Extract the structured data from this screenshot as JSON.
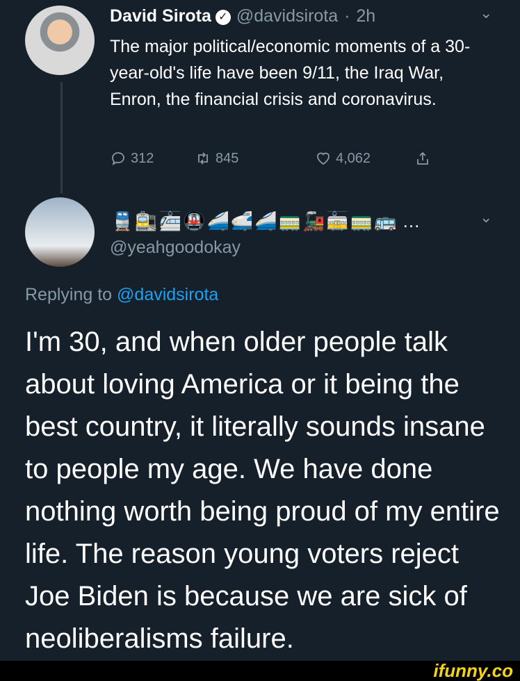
{
  "original_tweet": {
    "display_name": "David Sirota",
    "handle": "@davidsirota",
    "separator": "·",
    "time": "2h",
    "text": "The major political/economic moments of a 30-year-old's life have been 9/11, the Iraq War, Enron, the financial crisis and coronavirus.",
    "replies": "312",
    "retweets": "845",
    "likes": "4,062",
    "icons": {
      "verified": "verified-badge-icon",
      "reply": "reply-icon",
      "retweet": "retweet-icon",
      "like": "heart-icon",
      "share": "share-icon",
      "menu": "chevron-down-icon"
    }
  },
  "reply_tweet": {
    "display_name_emoji": "🚆🚉🚈🚇🚄🚅🚄🚃🚂🚋🚃🚌",
    "ellipsis": "…",
    "handle": "@yeahgoodokay",
    "replying_to_label": "Replying to",
    "replying_to_handle": "@davidsirota",
    "text": "I'm 30, and when older people talk about loving America or it being the best country, it literally sounds insane to people my age. We have done nothing worth being proud of my entire life. The reason young voters reject Joe Biden is because we are sick of neoliberalisms failure."
  },
  "watermark": {
    "text": "ifunny.co"
  },
  "colors": {
    "background": "#15202b",
    "text": "#ffffff",
    "muted": "#8899a6",
    "link": "#1da1f2",
    "watermark": "#f5d416"
  }
}
